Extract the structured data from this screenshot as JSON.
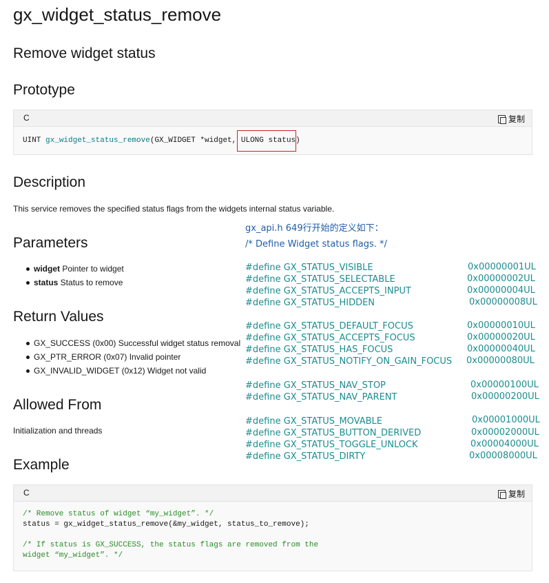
{
  "title": "gx_widget_status_remove",
  "subtitle": "Remove widget status",
  "prototype": {
    "heading": "Prototype",
    "lang": "C",
    "copy_label": "复制",
    "return_type": "UINT ",
    "func": "gx_widget_status_remove",
    "args_a": "(GX_WIDGET *widget, ",
    "args_b": "ULONG status",
    "args_c": ")"
  },
  "description": {
    "heading": "Description",
    "text": "This service removes the specified status flags from the widgets internal status variable."
  },
  "parameters": {
    "heading": "Parameters",
    "items": [
      {
        "name": "widget",
        "desc": " Pointer to widget"
      },
      {
        "name": "status",
        "desc": " Status to remove"
      }
    ]
  },
  "return_values": {
    "heading": "Return Values",
    "items": [
      "GX_SUCCESS (0x00) Successful widget status removal",
      "GX_PTR_ERROR (0x07) Invalid pointer",
      "GX_INVALID_WIDGET (0x12) Widget not valid"
    ]
  },
  "allowed_from": {
    "heading": "Allowed From",
    "text": "Initialization and threads"
  },
  "example": {
    "heading": "Example",
    "lang": "C",
    "copy_label": "复制",
    "lines": [
      {
        "text": "/* Remove status of widget “my_widget”. */",
        "comment": true
      },
      {
        "text": "status = gx_widget_status_remove(&my_widget, status_to_remove);",
        "comment": false
      },
      {
        "text": "",
        "comment": false
      },
      {
        "text": "/* If status is GX_SUCCESS, the status flags are removed from the",
        "comment": true
      },
      {
        "text": "widget “my_widget”. */",
        "comment": true
      }
    ]
  },
  "overlay": {
    "header": "gx_api.h     649行开始的定义如下：",
    "comment": "/* Define Widget status flags.  */",
    "defines": [
      {
        "name": "#define GX_STATUS_VISIBLE",
        "value": "0x00000001UL"
      },
      {
        "name": "#define GX_STATUS_SELECTABLE",
        "value": "0x00000002UL"
      },
      {
        "name": "#define GX_STATUS_ACCEPTS_INPUT",
        "value": "0x00000004UL"
      },
      {
        "name": "#define GX_STATUS_HIDDEN",
        "value": "0x00000008UL"
      },
      {
        "name": "#define GX_STATUS_DEFAULT_FOCUS",
        "value": "0x00000010UL"
      },
      {
        "name": "#define GX_STATUS_ACCEPTS_FOCUS",
        "value": "0x00000020UL"
      },
      {
        "name": "#define GX_STATUS_HAS_FOCUS",
        "value": "0x00000040UL"
      },
      {
        "name": "#define GX_STATUS_NOTIFY_ON_GAIN_FOCUS",
        "value": "0x00000080UL"
      },
      {
        "name": "#define GX_STATUS_NAV_STOP",
        "value": "0x00000100UL"
      },
      {
        "name": "#define GX_STATUS_NAV_PARENT",
        "value": "0x00000200UL"
      },
      {
        "name": "#define GX_STATUS_MOVABLE",
        "value": "0x00001000UL"
      },
      {
        "name": "#define GX_STATUS_BUTTON_DERIVED",
        "value": "0x00002000UL"
      },
      {
        "name": "#define GX_STATUS_TOGGLE_UNLOCK",
        "value": "0x00004000UL"
      },
      {
        "name": "#define GX_STATUS_DIRTY",
        "value": "0x00008000UL"
      }
    ]
  },
  "colors": {
    "function_link": "#0b7c86",
    "comment": "#2a8d2a",
    "highlight_box": "#d21f2a",
    "overlay_header": "#1f5da8",
    "overlay_define": "#1b8c8f"
  }
}
